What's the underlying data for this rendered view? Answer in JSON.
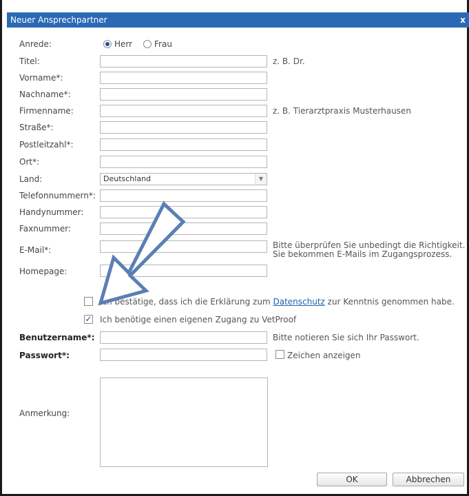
{
  "dialog": {
    "title": "Neuer Ansprechpartner",
    "close": "x"
  },
  "form": {
    "salutation": {
      "label": "Anrede:",
      "options": [
        "Herr",
        "Frau"
      ],
      "selected": "Herr"
    },
    "fields": {
      "title": {
        "label": "Titel:",
        "value": "",
        "hint": "z. B. Dr."
      },
      "firstname": {
        "label": "Vorname*:",
        "value": ""
      },
      "lastname": {
        "label": "Nachname*:",
        "value": ""
      },
      "company": {
        "label": "Firmenname:",
        "value": "",
        "hint": "z. B. Tierarztpraxis Musterhausen"
      },
      "street": {
        "label": "Straße*:",
        "value": ""
      },
      "zip": {
        "label": "Postleitzahl*:",
        "value": ""
      },
      "city": {
        "label": "Ort*:",
        "value": ""
      },
      "country": {
        "label": "Land:",
        "value": "Deutschland"
      },
      "phone": {
        "label": "Telefonnummern*:",
        "value": ""
      },
      "mobile": {
        "label": "Handynummer:",
        "value": ""
      },
      "fax": {
        "label": "Faxnummer:",
        "value": ""
      },
      "email": {
        "label": "E-Mail*:",
        "value": "",
        "hint_line1": "Bitte überprüfen Sie unbedingt die Richtigkeit.",
        "hint_line2": "Sie bekommen E-Mails im Zugangsprozess."
      },
      "homepage": {
        "label": "Homepage:",
        "value": ""
      }
    },
    "privacy": {
      "checked": false,
      "text_before": "Ich bestätige, dass ich die Erklärung zum",
      "link": "Datenschutz",
      "text_after": "zur Kenntnis genommen habe."
    },
    "own_access": {
      "checked": true,
      "text": "Ich benötige einen eigenen Zugang zu VetProof"
    },
    "username": {
      "label": "Benutzername*:",
      "value": "",
      "hint": "Bitte notieren Sie sich Ihr Passwort."
    },
    "password": {
      "label": "Passwort*:",
      "value": "",
      "show_chars_label": "Zeichen anzeigen",
      "show_chars_checked": false
    },
    "remark": {
      "label": "Anmerkung:",
      "value": ""
    }
  },
  "buttons": {
    "ok": "OK",
    "cancel": "Abbrechen"
  },
  "colors": {
    "titlebar": "#2b69b5",
    "arrow_fill": "#ffffff",
    "arrow_stroke": "#5b7fb5"
  }
}
